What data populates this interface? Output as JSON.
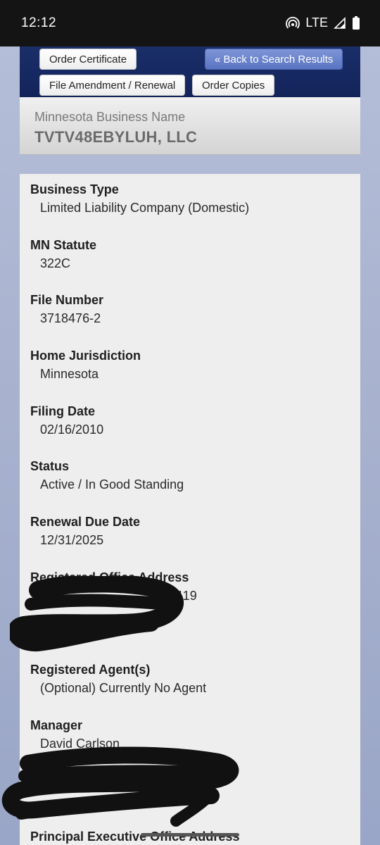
{
  "status_bar": {
    "time": "12:12",
    "network": "LTE",
    "icons": [
      "hotspot-icon",
      "signal-icon",
      "battery-icon"
    ]
  },
  "nav": {
    "order_certificate": "Order Certificate",
    "back_to_results": "« Back to Search Results",
    "file_amendment": "File Amendment / Renewal",
    "order_copies": "Order Copies"
  },
  "business": {
    "name_label": "Minnesota Business Name",
    "name": "TVTV48EBYLUH, LLC"
  },
  "details": {
    "business_type": {
      "label": "Business Type",
      "value": "Limited Liability Company (Domestic)"
    },
    "mn_statute": {
      "label": "MN Statute",
      "value": "322C"
    },
    "file_number": {
      "label": "File Number",
      "value": "3718476-2"
    },
    "home_jurisdiction": {
      "label": "Home Jurisdiction",
      "value": "Minnesota"
    },
    "filing_date": {
      "label": "Filing Date",
      "value": "02/16/2010"
    },
    "status": {
      "label": "Status",
      "value": "Active / In Good Standing"
    },
    "renewal_due_date": {
      "label": "Renewal Due Date",
      "value": "12/31/2025"
    },
    "registered_office": {
      "label": "Registered Office Address",
      "value": "#119"
    },
    "registered_agents": {
      "label": "Registered Agent(s)",
      "value": "(Optional) Currently No Agent"
    },
    "manager": {
      "label": "Manager",
      "value": "David Carlson"
    },
    "principal_office": {
      "label": "Principal Executive Office Address"
    }
  },
  "colors": {
    "navbar": "#13245a",
    "page_bg": "#aab4d0",
    "panel_bg": "#eeeeee",
    "redaction": "#111111"
  }
}
